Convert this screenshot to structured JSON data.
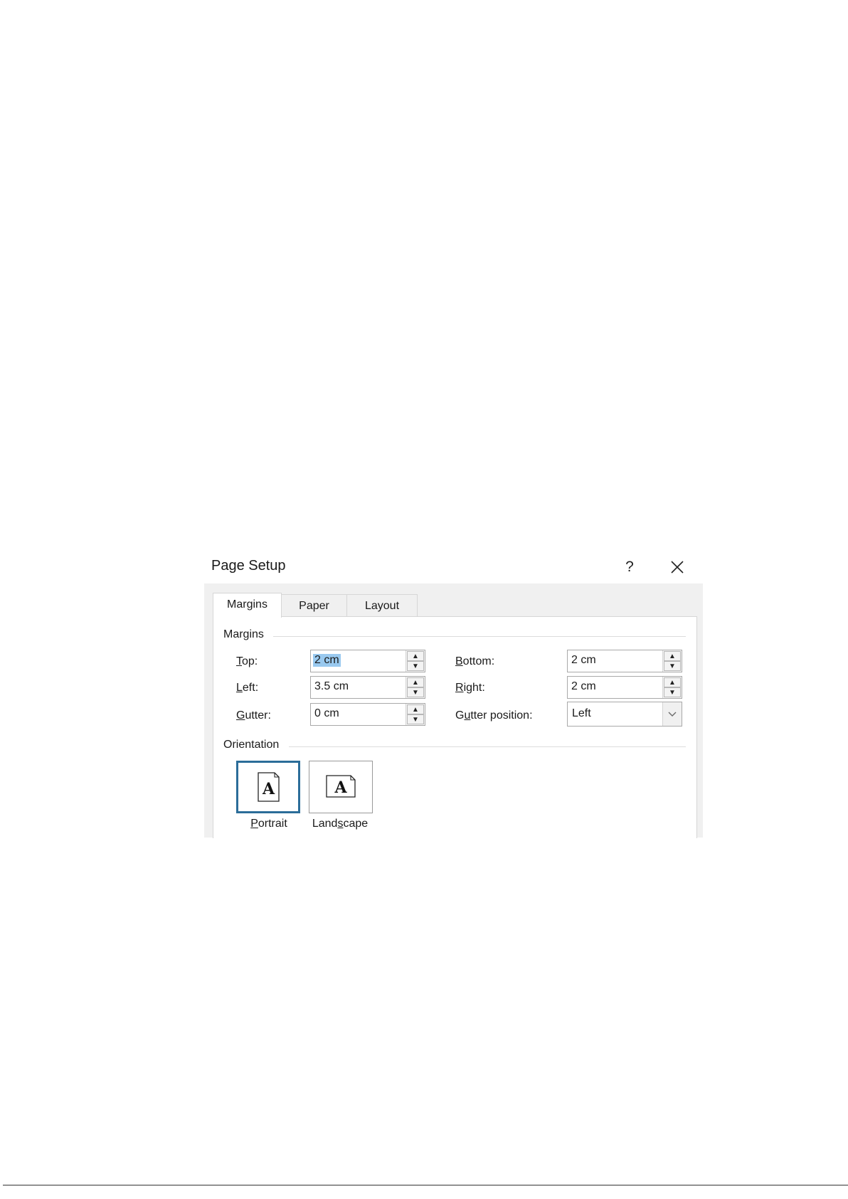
{
  "dialog": {
    "title": "Page Setup",
    "help_label": "?",
    "close_label": "×"
  },
  "tabs": [
    {
      "label": "Margins",
      "active": true
    },
    {
      "label": "Paper",
      "active": false
    },
    {
      "label": "Layout",
      "active": false
    }
  ],
  "margins": {
    "section_label": "Margins",
    "top": {
      "label_accel": "T",
      "label_rest": "op:",
      "value": "2 cm"
    },
    "left": {
      "label_accel": "L",
      "label_rest": "eft:",
      "value": "3.5 cm"
    },
    "gutter": {
      "label_accel": "G",
      "label_rest": "utter:",
      "value": "0 cm"
    },
    "bottom": {
      "label_accel": "B",
      "label_rest": "ottom:",
      "value": "2 cm"
    },
    "right": {
      "label_accel": "R",
      "label_rest": "ight:",
      "value": "2 cm"
    },
    "gutter_position": {
      "label_pre": "G",
      "label_accel": "u",
      "label_rest": "tter position:",
      "value": "Left"
    }
  },
  "orientation": {
    "section_label": "Orientation",
    "portrait": {
      "label_accel": "P",
      "label_rest": "ortrait",
      "glyph": "A",
      "selected": true
    },
    "landscape": {
      "label_pre": "Land",
      "label_accel": "s",
      "label_rest": "cape",
      "glyph": "A",
      "selected": false
    }
  },
  "colors": {
    "selection_highlight": "#99c9ef",
    "selected_border": "#2b6d99"
  }
}
